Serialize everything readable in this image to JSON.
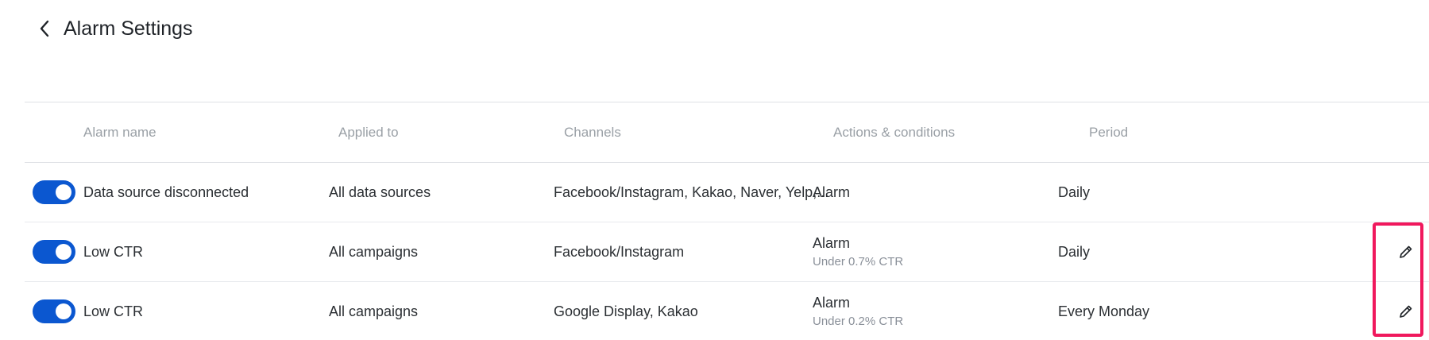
{
  "header": {
    "back_icon": "chevron-left-icon",
    "title": "Alarm Settings"
  },
  "table": {
    "columns": [
      "Alarm name",
      "Applied to",
      "Channels",
      "Actions & conditions",
      "Period"
    ],
    "rows": [
      {
        "enabled": true,
        "name": "Data source disconnected",
        "applied_to": "All data sources",
        "channels": "Facebook/Instagram, Kakao, Naver, Yelp,...",
        "action": "Alarm",
        "condition": "",
        "period": "Daily",
        "editable": false
      },
      {
        "enabled": true,
        "name": "Low CTR",
        "applied_to": "All campaigns",
        "channels": "Facebook/Instagram",
        "action": "Alarm",
        "condition": "Under 0.7% CTR",
        "period": "Daily",
        "editable": true
      },
      {
        "enabled": true,
        "name": "Low CTR",
        "applied_to": "All campaigns",
        "channels": "Google Display, Kakao",
        "action": "Alarm",
        "condition": "Under 0.2% CTR",
        "period": "Every Monday",
        "editable": true
      }
    ]
  },
  "colors": {
    "toggle_on": "#0b57d0",
    "highlight": "#f0185d",
    "header_text": "#9aa0a6"
  },
  "icons": {
    "edit": "pencil-icon"
  }
}
